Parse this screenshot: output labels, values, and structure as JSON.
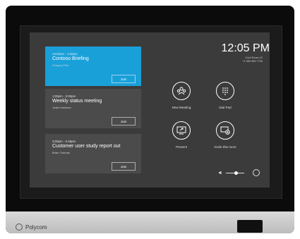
{
  "meetings": [
    {
      "time": "10:00am - 1:00pm",
      "title": "Contoso Briefing",
      "organizer": "Gregory Flint",
      "join_label": "Join"
    },
    {
      "time": "1:00pm - 3:00pm",
      "title": "Weekly status meeting",
      "organizer": "Justin Harrison",
      "join_label": "Join"
    },
    {
      "time": "3:00pm - 3:45pm",
      "title": "Customer user study report out",
      "organizer": "Brian Thomas",
      "join_label": "Join"
    }
  ],
  "clock": {
    "time": "12:05 PM",
    "room_name": "Conf Room 12",
    "room_phone": "+1 555 555 7799"
  },
  "actions": [
    {
      "label": "New Meeting",
      "icon": "people-icon"
    },
    {
      "label": "Dial Pad",
      "icon": "dialpad-icon"
    },
    {
      "label": "Present",
      "icon": "present-icon"
    },
    {
      "label": "Invite this room",
      "icon": "invite-room-icon"
    }
  ],
  "volume": {
    "level": 0.55
  },
  "brand": {
    "name": "Polycom"
  },
  "colors": {
    "accent": "#1aa0d9",
    "screen_bg": "#3b3b3b",
    "card_bg": "#4b4b4b"
  }
}
